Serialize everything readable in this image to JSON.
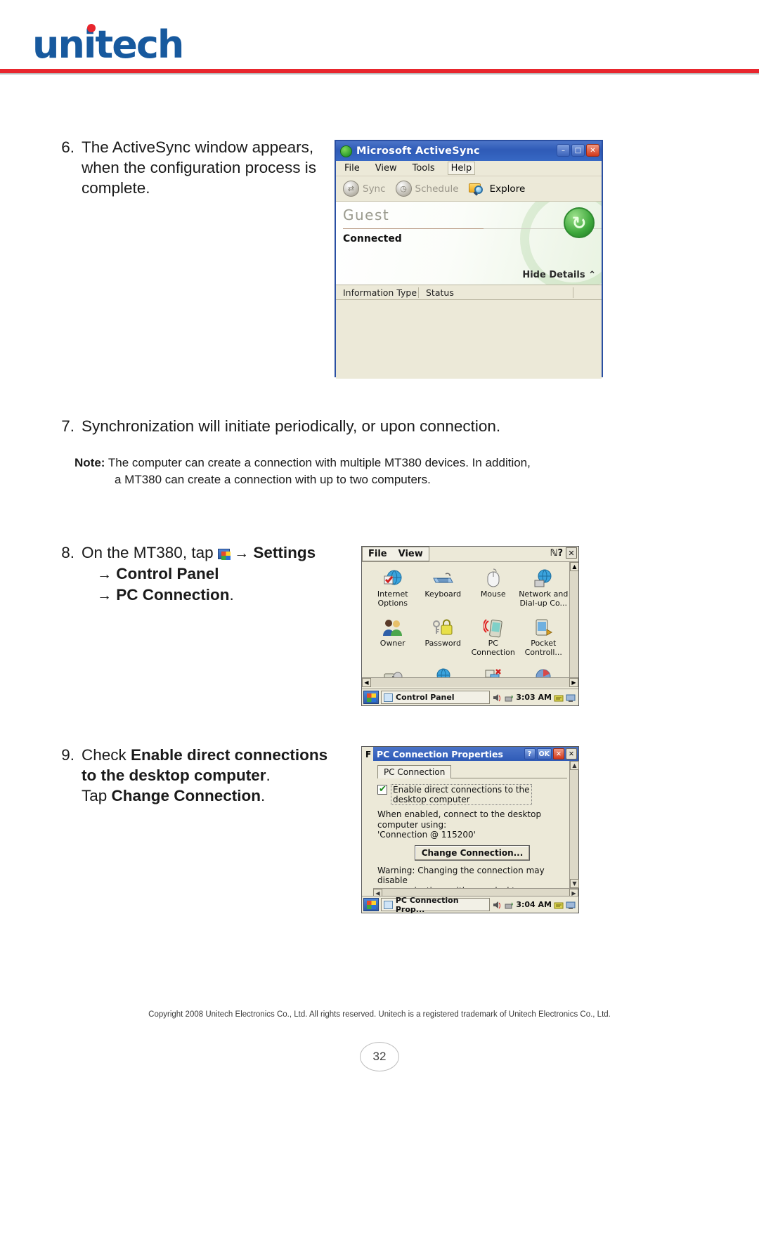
{
  "header": {
    "logo_text": "unitech",
    "logo_color": "#17599e",
    "accent_color": "#e8262d"
  },
  "steps": {
    "s6": {
      "num": "6.",
      "line1": "The ActiveSync window appears,",
      "line2": "when the configuration process is",
      "line3": "complete."
    },
    "s7": {
      "num": "7.",
      "line1": "Synchronization will initiate periodically, or upon connection."
    },
    "s8": {
      "num": "8.",
      "line1_pre": "On the MT380, tap",
      "line1_arrow": "→",
      "line1_bold": "Settings",
      "line2_arrow": "→",
      "line2_bold": "Control Panel",
      "line3_arrow": "→",
      "line3_bold": "PC Connection",
      "line3_end": "."
    },
    "s9": {
      "num": "9.",
      "line1_pre": "Check ",
      "line1_bold": "Enable direct connections",
      "line2_bold": "to the desktop computer",
      "line2_end": ".",
      "line3_pre": "Tap ",
      "line3_bold": "Change Connection",
      "line3_end": "."
    }
  },
  "note": {
    "label": "Note:",
    "line1": "The computer can create a connection with multiple MT380 devices. In addition,",
    "line2": "a MT380 can create a connection with up to two computers."
  },
  "activesync": {
    "title": "Microsoft ActiveSync",
    "menus": [
      "File",
      "View",
      "Tools",
      "Help"
    ],
    "toolbar": [
      {
        "label": "Sync",
        "enabled": false
      },
      {
        "label": "Schedule",
        "enabled": false
      },
      {
        "label": "Explore",
        "enabled": true
      }
    ],
    "profile_name": "Guest",
    "status": "Connected",
    "hide_details": "Hide Details",
    "hide_details_chevron": "⌃",
    "columns": [
      "Information Type",
      "Status"
    ],
    "window_buttons": {
      "minimize": "–",
      "maximize": "□",
      "close": "✕"
    }
  },
  "control_panel": {
    "menus": [
      "File",
      "View"
    ],
    "help_icon": "ℕ?",
    "close_label": "✕",
    "icons": [
      {
        "label": "Internet Options",
        "icon": "internet-options-icon"
      },
      {
        "label": "Keyboard",
        "icon": "keyboard-icon"
      },
      {
        "label": "Mouse",
        "icon": "mouse-icon"
      },
      {
        "label": "Network and Dial-up Co...",
        "icon": "network-dialup-icon"
      },
      {
        "label": "Owner",
        "icon": "owner-icon"
      },
      {
        "label": "Password",
        "icon": "password-icon"
      },
      {
        "label": "PC Connection",
        "icon": "pc-connection-icon"
      },
      {
        "label": "Pocket Controll...",
        "icon": "pocket-controller-icon"
      },
      {
        "label": "",
        "icon": "power-icon"
      },
      {
        "label": "",
        "icon": "regional-settings-icon"
      },
      {
        "label": "",
        "icon": "remove-programs-icon"
      },
      {
        "label": "",
        "icon": "storage-icon"
      }
    ],
    "taskbar": {
      "button_label": "Control Panel",
      "time": "3:03 AM"
    },
    "scroll": {
      "up": "▲",
      "down": "▼",
      "left": "◀",
      "right": "▶"
    }
  },
  "pc_connection_properties": {
    "behind_window_label": "F",
    "title": "PC Connection Properties",
    "buttons": {
      "help": "?",
      "ok": "OK",
      "close": "✕",
      "outer_close": "✕"
    },
    "tab": "PC Connection",
    "checkbox_label_line1": "Enable direct connections to the",
    "checkbox_label_line2": "desktop computer",
    "checkbox_checked": true,
    "desc_line1": "When enabled, connect to the desktop",
    "desc_line2": "computer using:",
    "connection_value": "'Connection @ 115200'",
    "change_button": "Change Connection...",
    "warning_line1": "Warning: Changing the connection may disable",
    "warning_line2": "communications with your desktop computer.",
    "taskbar": {
      "button_label": "PC Connection Prop...",
      "time": "3:04 AM"
    },
    "scroll": {
      "up": "▲",
      "down": "▼",
      "left": "◀",
      "right": "▶"
    }
  },
  "footer": {
    "copyright": "Copyright 2008 Unitech Electronics Co., Ltd. All rights reserved. Unitech is a registered trademark of Unitech Electronics Co., Ltd.",
    "page_number": "32"
  }
}
